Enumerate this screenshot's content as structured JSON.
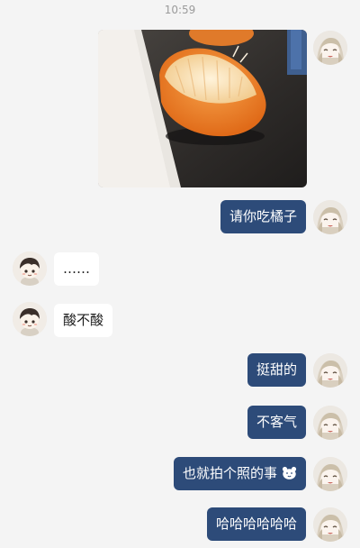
{
  "chat": {
    "timestamp": "10:59",
    "messages": [
      {
        "side": "out",
        "type": "image",
        "image_description": "photo of a half-peeled orange on a dark table"
      },
      {
        "side": "out",
        "type": "text",
        "text": "请你吃橘子"
      },
      {
        "side": "in",
        "type": "text",
        "text": "……"
      },
      {
        "side": "in",
        "type": "text",
        "text": "酸不酸"
      },
      {
        "side": "out",
        "type": "text",
        "text": "挺甜的"
      },
      {
        "side": "out",
        "type": "text",
        "text": "不客气"
      },
      {
        "side": "out",
        "type": "text",
        "text": "也就拍个照的事",
        "emoji": "bear-face"
      },
      {
        "side": "out",
        "type": "text",
        "text": "哈哈哈哈哈哈"
      }
    ]
  },
  "colors": {
    "background": "#f4f4f4",
    "outgoing_bubble": "#2d4b79",
    "incoming_bubble": "#ffffff",
    "timestamp_text": "#9b9b9b"
  }
}
